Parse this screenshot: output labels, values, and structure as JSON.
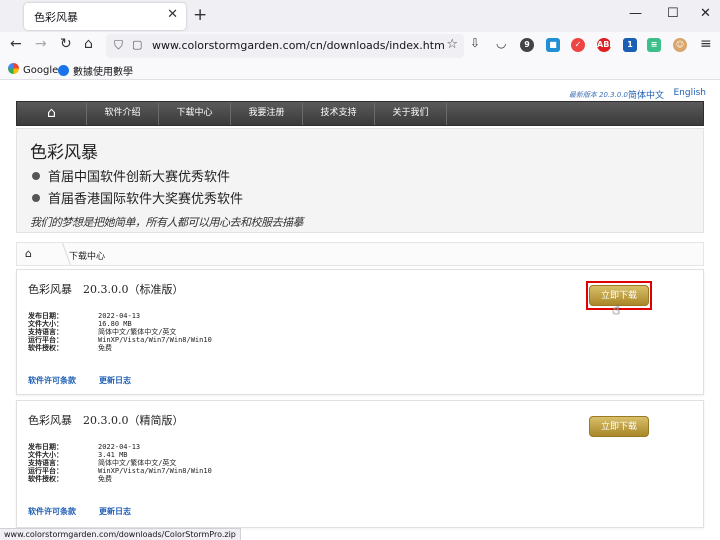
{
  "browser": {
    "tab_title": "色彩风暴",
    "url": "www.colorstormgarden.com/cn/downloads/index.htm",
    "bookmarks": [
      {
        "label": "Google",
        "icon": "google-icon"
      },
      {
        "label": "數據使用數學",
        "icon": "bookmark-globe-icon"
      }
    ],
    "status_text": "www.colorstormgarden.com/downloads/ColorStormPro.zip",
    "ext_badge": "1"
  },
  "site": {
    "version_label": "最新版本 20.3.0.0",
    "lang_zh": "简体中文",
    "lang_en": "English",
    "nav": [
      "软件介绍",
      "下载中心",
      "我要注册",
      "技术支持",
      "关于我们"
    ],
    "banner_title": "色彩风暴",
    "awards": [
      "首届中国软件创新大赛优秀软件",
      "首届香港国际软件大奖赛优秀软件"
    ],
    "slogan": "我们的梦想是把她简单，所有人都可以用心去和校服去描摹",
    "breadcrumb": "下载中心"
  },
  "downloads": [
    {
      "title": "色彩风暴　20.3.0.0（标准版）",
      "button": "立即下载",
      "rows": [
        {
          "label": "发布日期：",
          "value": "2022-04-13"
        },
        {
          "label": "文件大小：",
          "value": "16.80 MB"
        },
        {
          "label": "支持语言：",
          "value": "简体中文/繁体中文/英文"
        },
        {
          "label": "运行平台：",
          "value": "WinXP/Vista/Win7/Win8/Win10"
        },
        {
          "label": "软件授权：",
          "value": "免费"
        }
      ],
      "link_license": "软件许可条款",
      "link_changelog": "更新日志"
    },
    {
      "title": "色彩风暴　20.3.0.0（精简版）",
      "button": "立即下载",
      "rows": [
        {
          "label": "发布日期：",
          "value": "2022-04-13"
        },
        {
          "label": "文件大小：",
          "value": "3.41 MB"
        },
        {
          "label": "支持语言：",
          "value": "简体中文/繁体中文/英文"
        },
        {
          "label": "运行平台：",
          "value": "WinXP/Vista/Win7/Win8/Win10"
        },
        {
          "label": "软件授权：",
          "value": "免费"
        }
      ],
      "link_license": "软件许可条款",
      "link_changelog": "更新日志"
    }
  ],
  "colors": {
    "nav_bg": "#4a4a4a",
    "link": "#1f5fb4",
    "button_gold": "#c4a440",
    "highlight": "#e00000"
  }
}
